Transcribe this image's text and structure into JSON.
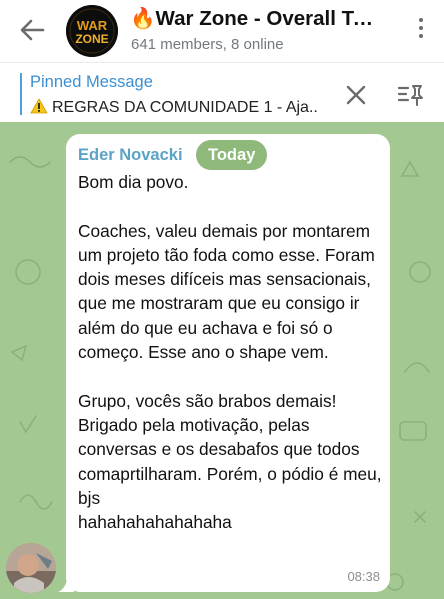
{
  "header": {
    "title": "🔥War Zone - Overall Team",
    "subtitle": "641 members, 8 online",
    "logo_text_top": "WAR",
    "logo_text_bottom": "ZONE"
  },
  "pinned": {
    "label": "Pinned Message",
    "text": "REGRAS DA COMUNIDADE 1 - Aja.."
  },
  "message": {
    "sender": "Eder Novacki",
    "date_badge": "Today",
    "text": "Bom dia povo.\n\nCoaches, valeu demais por montarem um projeto tão foda como esse. Foram dois meses difíceis mas sensacionais, que me mostraram que eu consigo ir além do que eu achava e foi só o começo. Esse ano o shape vem.\n\nGrupo, vocês são brabos demais! Brigado pela motivação, pelas conversas e os desabafos que todos comaprtilharam. Porém, o pódio é meu, bjs\nhahahahahahahaha",
    "time": "08:38"
  },
  "colors": {
    "chat_bg": "#a4c892",
    "sender": "#5aa3c4",
    "pinned_label": "#3c8fd2",
    "date_pill": "#8eb97b"
  }
}
